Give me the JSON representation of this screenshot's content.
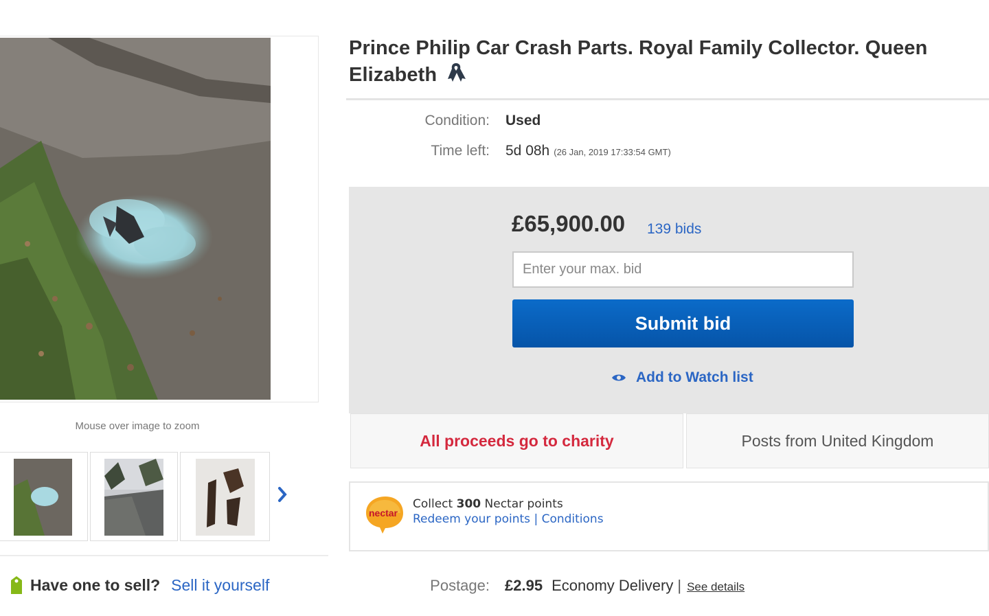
{
  "listing": {
    "title": "Prince Philip Car Crash Parts. Royal Family Collector. Queen Elizabeth",
    "title_icon": "awareness-ribbon-icon"
  },
  "gallery": {
    "zoom_hint": "Mouse over image to zoom",
    "next_icon": "chevron-right-icon"
  },
  "details": {
    "condition_label": "Condition:",
    "condition_value": "Used",
    "time_left_label": "Time left:",
    "time_left_value": "5d 08h",
    "time_left_end": "(26 Jan, 2019   17:33:54 GMT)"
  },
  "bid": {
    "price": "£65,900.00",
    "bids_count": "139 bids",
    "input_placeholder": "Enter your max. bid",
    "submit_label": "Submit bid",
    "watch_label": "Add to Watch list",
    "button_color": "#0654a8",
    "link_color": "#2b66c4"
  },
  "info": {
    "charity": "All proceeds go to charity",
    "charity_color": "#d4293e",
    "posts_from": "Posts from United Kingdom"
  },
  "nectar": {
    "logo_text": "nectar",
    "collect_prefix": "Collect",
    "points": "300",
    "collect_suffix": "Nectar points",
    "redeem_link": "Redeem your points",
    "separator": "|",
    "conditions_link": "Conditions"
  },
  "postage": {
    "label": "Postage:",
    "price": "£2.95",
    "method": "Economy Delivery",
    "separator": "|",
    "see_details": "See details"
  },
  "sell": {
    "question": "Have one to sell?",
    "link": "Sell it yourself"
  }
}
